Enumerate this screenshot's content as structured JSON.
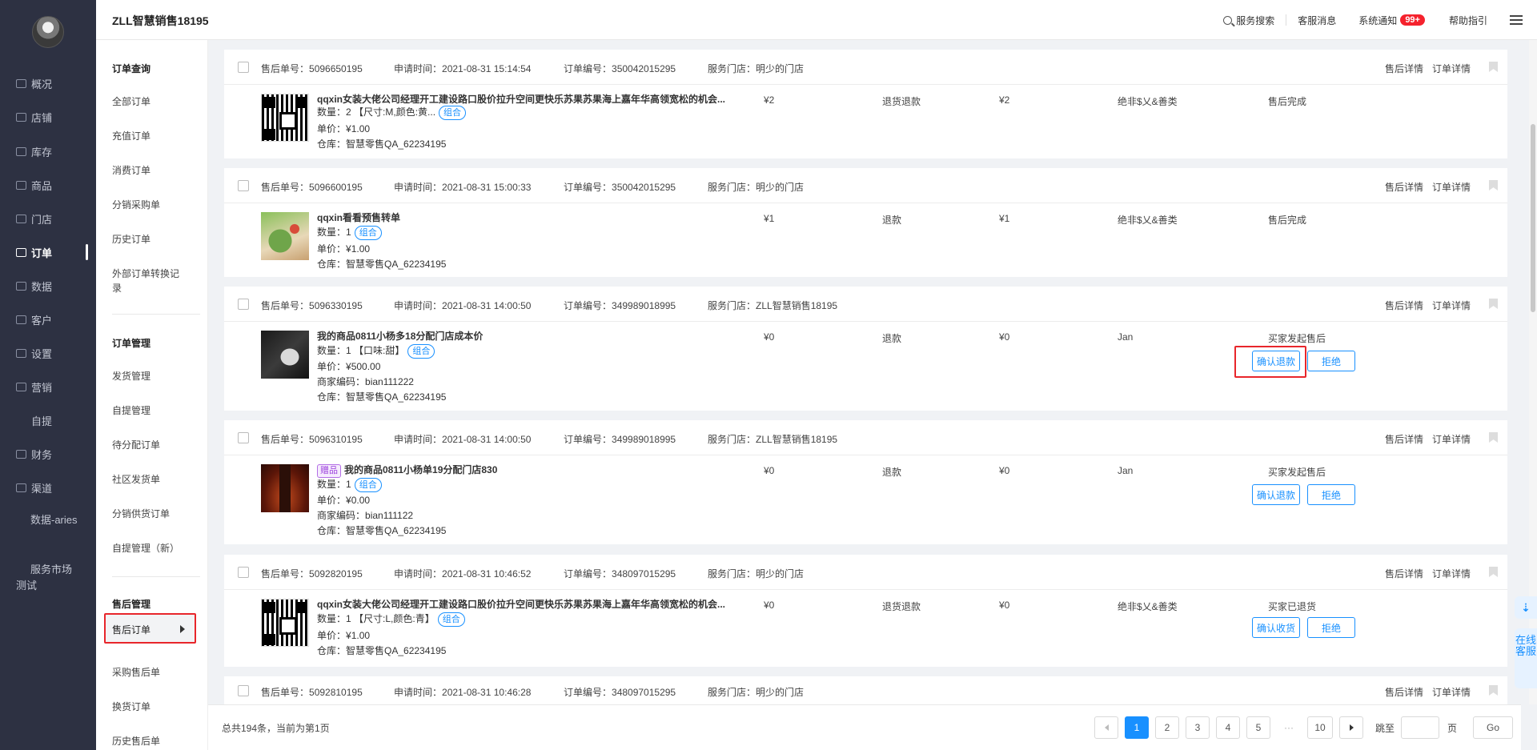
{
  "nav": {
    "items": [
      {
        "label": "概况"
      },
      {
        "label": "店铺"
      },
      {
        "label": "库存"
      },
      {
        "label": "商品"
      },
      {
        "label": "门店"
      },
      {
        "label": "订单"
      },
      {
        "label": "数据"
      },
      {
        "label": "客户"
      },
      {
        "label": "设置"
      },
      {
        "label": "营销"
      },
      {
        "label": "自提"
      },
      {
        "label": "财务"
      },
      {
        "label": "渠道"
      },
      {
        "label": "数据-aries"
      },
      {
        "label": "服务市场测试"
      }
    ],
    "active": "订单"
  },
  "header": {
    "store_name": "ZLL智慧销售18195",
    "search": "服务搜索",
    "messages": "客服消息",
    "notifications": "系统通知",
    "notif_badge": "99+",
    "help": "帮助指引"
  },
  "submenu": {
    "group1": "订单查询",
    "group1_items": [
      "全部订单",
      "充值订单",
      "消费订单",
      "分销采购单",
      "历史订单",
      "外部订单转换记录"
    ],
    "group2": "订单管理",
    "group2_items": [
      "发货管理",
      "自提管理",
      "待分配订单",
      "社区发货单",
      "分销供货订单",
      "自提管理（新）"
    ],
    "group3": "售后管理",
    "active_item": "售后订单",
    "group3_items": [
      "采购售后单",
      "换货订单",
      "历史售后单"
    ]
  },
  "labels": {
    "after_sale_no": "售后单号：",
    "apply_time": "申请时间：",
    "order_no": "订单编号：",
    "store": "服务门店：",
    "after_sale_detail": "售后详情",
    "order_detail": "订单详情",
    "qty": "数量：",
    "unit_price": "单价：",
    "merchant_code": "商家编码：",
    "warehouse": "仓库：",
    "combo": "组合",
    "gift": "赠品"
  },
  "orders": [
    {
      "after_sale_no": "5096650195",
      "apply_time": "2021-08-31 15:14:54",
      "order_no": "350042015295",
      "store": "明少的门店",
      "image": "qr-code",
      "name": "qqxin女装大佬公司经理开工建设路口股价拉升空间更快乐苏果苏果海上嘉年华高领宽松的机会...",
      "qty": "2 【尺寸:M,颜色:黄...",
      "unit_price": "¥1.00",
      "warehouse": "智慧零售QA_62234195",
      "amount": "¥2",
      "type": "退货退款",
      "refund": "¥2",
      "buyer": "绝非$乂&善类",
      "status": "售后完成"
    },
    {
      "after_sale_no": "5096600195",
      "apply_time": "2021-08-31 15:00:33",
      "order_no": "350042015295",
      "store": "明少的门店",
      "image": "plant-photo",
      "name": "qqxin看看预售转单",
      "qty": "1",
      "unit_price": "¥1.00",
      "warehouse": "智慧零售QA_62234195",
      "amount": "¥1",
      "type": "退款",
      "refund": "¥1",
      "buyer": "绝非$乂&善类",
      "status": "售后完成"
    },
    {
      "after_sale_no": "5096330195",
      "apply_time": "2021-08-31 14:00:50",
      "order_no": "349989018995",
      "store": "ZLL智慧销售18195",
      "image": "tablet-photo",
      "name": "我的商品0811小杨多18分配门店成本价",
      "qty": "1 【口味:甜】",
      "unit_price": "¥500.00",
      "merchant_code": "bian111222",
      "warehouse": "智慧零售QA_62234195",
      "amount": "¥0",
      "type": "退款",
      "refund": "¥0",
      "buyer": "Jan",
      "status": "买家发起售后",
      "btn1": "确认退款",
      "btn2": "拒绝"
    },
    {
      "after_sale_no": "5096310195",
      "apply_time": "2021-08-31 14:00:50",
      "order_no": "349989018995",
      "store": "ZLL智慧销售18195",
      "image": "cognac-photo",
      "name": "我的商品0811小杨单19分配门店830",
      "qty": "1",
      "unit_price": "¥0.00",
      "merchant_code": "bian111122",
      "warehouse": "智慧零售QA_62234195",
      "amount": "¥0",
      "type": "退款",
      "refund": "¥0",
      "buyer": "Jan",
      "status": "买家发起售后",
      "btn1": "确认退款",
      "btn2": "拒绝"
    },
    {
      "after_sale_no": "5092820195",
      "apply_time": "2021-08-31 10:46:52",
      "order_no": "348097015295",
      "store": "明少的门店",
      "image": "qr-code",
      "name": "qqxin女装大佬公司经理开工建设路口股价拉升空间更快乐苏果苏果海上嘉年华高领宽松的机会...",
      "qty": "1 【尺寸:L,颜色:青】",
      "unit_price": "¥1.00",
      "warehouse": "智慧零售QA_62234195",
      "amount": "¥0",
      "type": "退货退款",
      "refund": "¥0",
      "buyer": "绝非$乂&善类",
      "status": "买家已退货",
      "btn1": "确认收货",
      "btn2": "拒绝"
    },
    {
      "after_sale_no": "5092810195",
      "apply_time": "2021-08-31 10:46:28",
      "order_no": "348097015295",
      "store": "明少的门店"
    }
  ],
  "pagination": {
    "total": "总共194条，当前为第1页",
    "pages": [
      "1",
      "2",
      "3",
      "4",
      "5",
      "···",
      "10"
    ],
    "current": "1",
    "jump_label": "跳至",
    "page_unit": "页",
    "go": "Go"
  },
  "side": {
    "download_icon": "⇣",
    "cs_label": "在线客服"
  }
}
